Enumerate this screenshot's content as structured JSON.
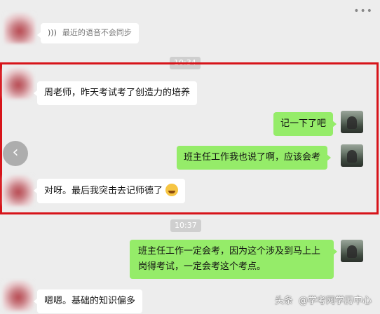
{
  "chat": {
    "voice_notice": "最近的语音不会同步",
    "time_1": "10:34",
    "time_2": "10:37",
    "messages": [
      {
        "side": "left",
        "text": "周老师，昨天考试考了创造力的培养"
      },
      {
        "side": "right",
        "text": "记一下了吧"
      },
      {
        "side": "right",
        "text": "班主任工作我也说了啊，应该会考"
      },
      {
        "side": "left",
        "text": "对呀。最后我突击去记师德了"
      },
      {
        "side": "right",
        "text": "班主任工作一定会考，因为这个涉及到马上上岗得考试，一定会考这个考点。"
      },
      {
        "side": "left",
        "text": "嗯嗯。基础的知识偏多"
      }
    ]
  },
  "watermark": {
    "prefix": "头条",
    "handle": "@学考网学历中心"
  },
  "icons": {
    "voice": "voice-wave-icon",
    "back": "chevron-left-icon",
    "more": "more-dots-icon",
    "emoji": "laughing-tears-emoji-icon"
  },
  "colors": {
    "background": "#ededed",
    "bubble_self": "#95ec69",
    "bubble_other": "#ffffff",
    "highlight_border": "#d7141a"
  }
}
